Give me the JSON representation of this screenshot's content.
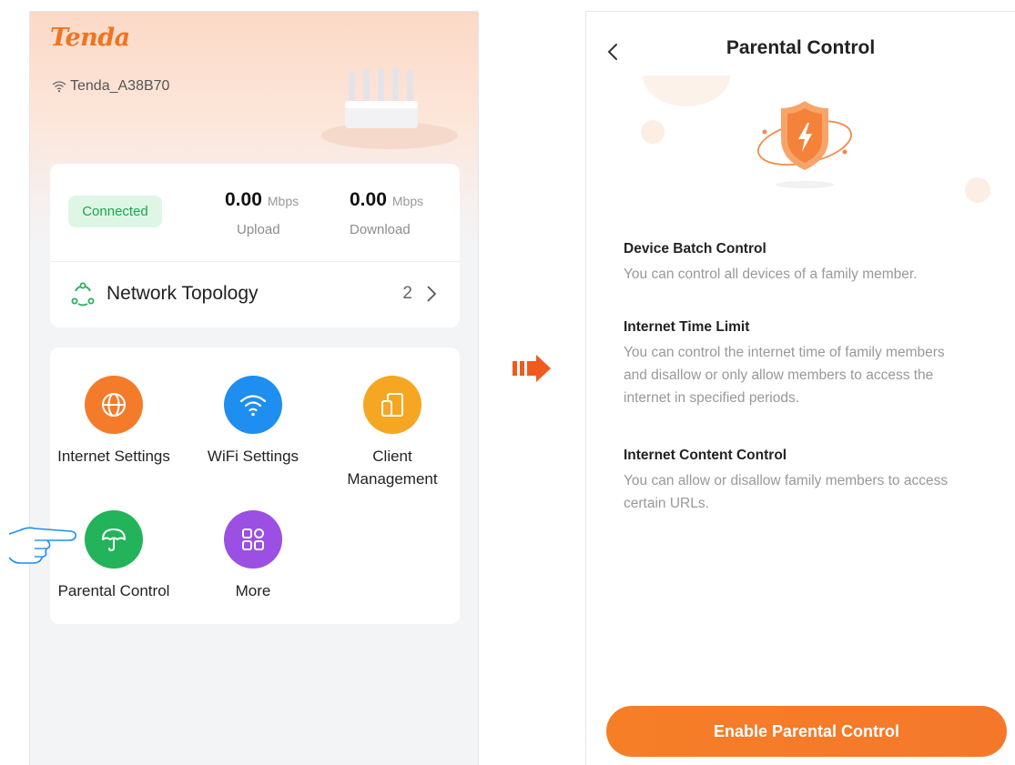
{
  "left": {
    "brand": "Tenda",
    "ssid": "Tenda_A38B70",
    "status": {
      "connection": "Connected",
      "upload": {
        "value": "0.00",
        "unit": "Mbps",
        "label": "Upload"
      },
      "download": {
        "value": "0.00",
        "unit": "Mbps",
        "label": "Download"
      }
    },
    "topology": {
      "label": "Network Topology",
      "count": "2"
    },
    "menu": [
      {
        "label": "Internet Settings",
        "icon": "globe-icon",
        "color": "#f47b2a"
      },
      {
        "label": "WiFi Settings",
        "icon": "wifi-icon",
        "color": "#1e8ef0"
      },
      {
        "label": "Client\nManagement",
        "icon": "devices-icon",
        "color": "#f5a623"
      },
      {
        "label": "Parental Control",
        "icon": "umbrella-icon",
        "color": "#23b35b"
      },
      {
        "label": "More",
        "icon": "grid-icon",
        "color": "#9b4fe3"
      }
    ]
  },
  "right": {
    "title": "Parental Control",
    "features": [
      {
        "title": "Device Batch Control",
        "desc": "You can control all devices of a family member."
      },
      {
        "title": "Internet Time Limit",
        "desc": "You can control the internet time of family members and disallow or only allow members to access the internet in specified periods."
      },
      {
        "title": "Internet Content Control",
        "desc": "You can allow or disallow family members to access certain URLs."
      }
    ],
    "button": "Enable Parental Control"
  },
  "colors": {
    "accent": "#f47b2a",
    "connected": "#19a74a",
    "header_gradient": "#fbd9c6"
  }
}
